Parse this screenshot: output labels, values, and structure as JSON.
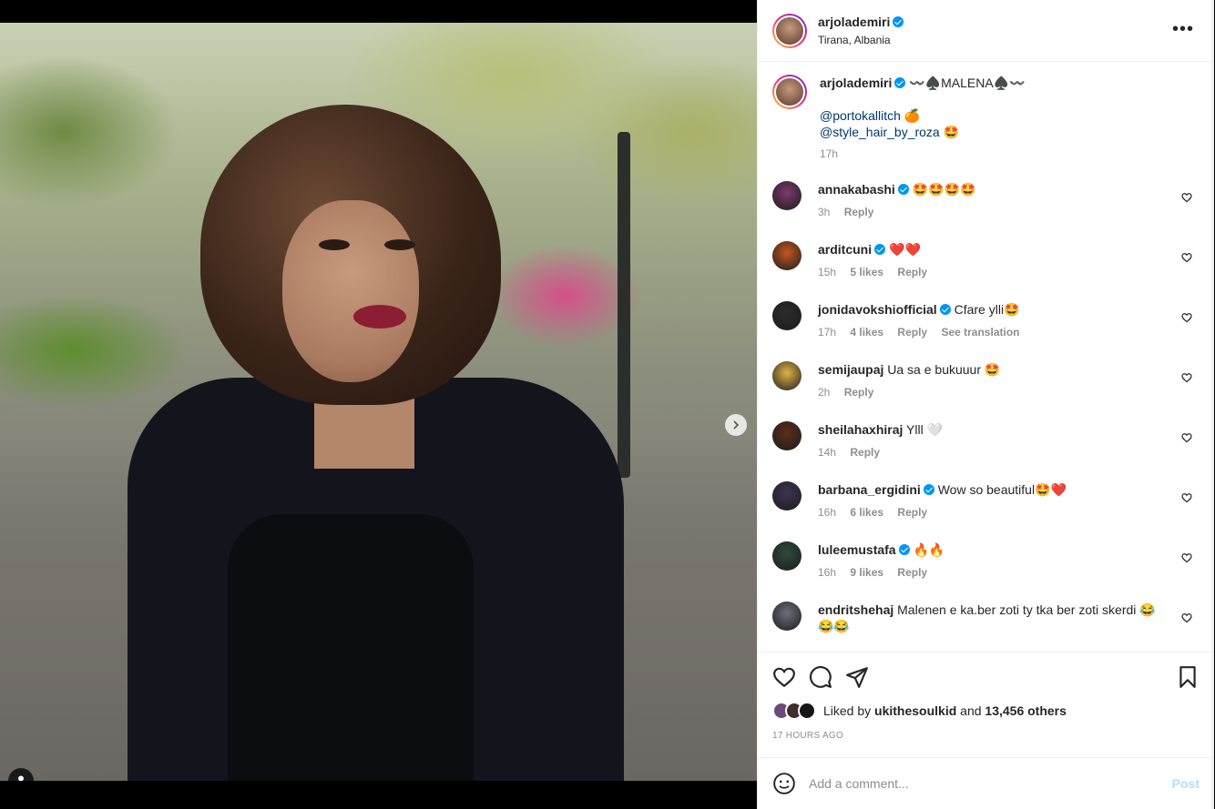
{
  "post": {
    "author": "arjolademiri",
    "location": "Tirana, Albania",
    "more_icon": "more-horizontal-icon",
    "carousel": {
      "total_slides": 2,
      "active_slide": 1
    }
  },
  "caption": {
    "author": "arjolademiri",
    "title": "〰️♠️MALENA♠️〰️",
    "mention1": "@portokallitch",
    "mention1_suffix": "🍊",
    "mention2": "@style_hair_by_roza",
    "mention2_suffix": "🤩",
    "time": "17h"
  },
  "comments": [
    {
      "user": "annakabashi",
      "verified": true,
      "text": "🤩🤩🤩🤩",
      "time": "3h",
      "likes": "",
      "reply": "Reply",
      "translate": "",
      "avatar_color": "#7a3a6b"
    },
    {
      "user": "arditcuni",
      "verified": true,
      "text": "❤️❤️",
      "time": "15h",
      "likes": "5 likes",
      "reply": "Reply",
      "translate": "",
      "avatar_color": "#c2561e"
    },
    {
      "user": "jonidavokshiofficial",
      "verified": true,
      "text": "Cfare ylli🤩",
      "time": "17h",
      "likes": "4 likes",
      "reply": "Reply",
      "translate": "See translation",
      "avatar_color": "#2b2b2b"
    },
    {
      "user": "semijaupaj",
      "verified": false,
      "text": "Ua sa e bukuuur 🤩",
      "time": "2h",
      "likes": "",
      "reply": "Reply",
      "translate": "",
      "avatar_color": "#e0b247"
    },
    {
      "user": "sheilahaxhiraj",
      "verified": false,
      "text": "Ylll 🤍",
      "time": "14h",
      "likes": "",
      "reply": "Reply",
      "translate": "",
      "avatar_color": "#5a2e1a"
    },
    {
      "user": "barbana_ergidini",
      "verified": true,
      "text": "Wow so beautiful🤩❤️",
      "time": "16h",
      "likes": "6 likes",
      "reply": "Reply",
      "translate": "",
      "avatar_color": "#3f3353"
    },
    {
      "user": "luleemustafa",
      "verified": true,
      "text": "🔥🔥",
      "time": "16h",
      "likes": "9 likes",
      "reply": "Reply",
      "translate": "",
      "avatar_color": "#2f4a3c"
    },
    {
      "user": "endritshehaj",
      "verified": false,
      "text": "Malenen e ka.ber zoti ty tka ber zoti skerdi 😂😂😂",
      "time": "",
      "likes": "",
      "reply": "",
      "translate": "",
      "avatar_color": "#6b6f7a"
    }
  ],
  "actions": {
    "like_icon": "heart-icon",
    "comment_icon": "comment-icon",
    "share_icon": "send-icon",
    "save_icon": "bookmark-icon",
    "liked_by_prefix": "Liked by",
    "liked_by_user": "ukithesoulkid",
    "liked_by_and": "and",
    "liked_by_count": "13,456 others",
    "timestamp": "17 HOURS AGO"
  },
  "add_comment": {
    "placeholder": "Add a comment...",
    "post_label": "Post"
  },
  "colors": {
    "verified": "#0095f6",
    "mention": "#00376b",
    "post_disabled": "#b2dffc"
  }
}
